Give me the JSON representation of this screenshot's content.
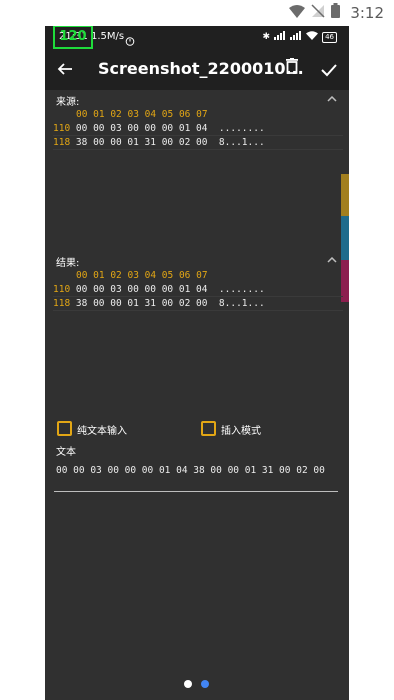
{
  "system_status": {
    "time": "3:12"
  },
  "device_status": {
    "fps": "120",
    "time_speed": "21:31 1.5M/s",
    "battery": "46"
  },
  "toolbar": {
    "title": "Screenshot_2200010..."
  },
  "source": {
    "label": "来源:",
    "header": "00 01 02 03 04 05 06 07",
    "rows": [
      {
        "addr": "110",
        "bytes": "00 00 03 00 00 00 01 04",
        "ascii": "........"
      },
      {
        "addr": "118",
        "bytes": "38 00 00 01 31 00 02 00",
        "ascii": "8...1..."
      }
    ]
  },
  "result": {
    "label": "结果:",
    "header": "00 01 02 03 04 05 06 07",
    "rows": [
      {
        "addr": "110",
        "bytes": "00 00 03 00 00 00 01 04",
        "ascii": "........"
      },
      {
        "addr": "118",
        "bytes": "38 00 00 01 31 00 02 00",
        "ascii": "8...1..."
      }
    ]
  },
  "options": {
    "plain_text_label": "纯文本输入",
    "insert_mode_label": "插入模式"
  },
  "text_input": {
    "label": "文本",
    "value": "00 00 03 00 00 00 01 04 38 00 00 01 31 00 02 00"
  },
  "colors": {
    "accent": "#e2a615",
    "page_dot_active": "#4285f4",
    "page_dot_inactive": "#ffffff"
  },
  "side_strip_colors": [
    "#a27f1f",
    "#1f6b8c",
    "#8c1f4f"
  ]
}
